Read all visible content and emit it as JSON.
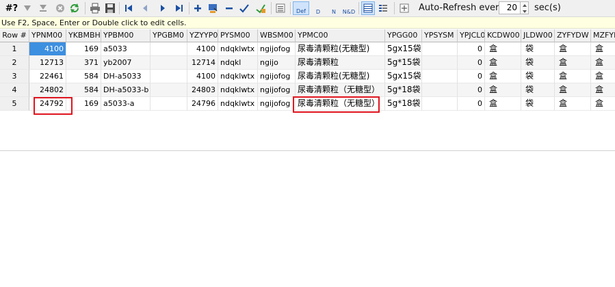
{
  "toolbar": {
    "filter_label": "#?",
    "auto_refresh_label": "Auto-Refresh every",
    "auto_refresh_value": "20",
    "auto_refresh_unit": "sec(s)",
    "def_label": "Def",
    "d_label": "D",
    "n_label": "N",
    "nd_label": "N&D"
  },
  "hint": "Use F2, Space, Enter or Double click to edit cells.",
  "grid": {
    "columns": [
      "Row #",
      "YPNM00",
      "YKBMBH",
      "YPBM00",
      "YPGBM0",
      "YZYYP0",
      "PYSM00",
      "WBSM00",
      "YPMC00",
      "YPGG00",
      "YPSYSM",
      "YPJCL0",
      "KCDW00",
      "JLDW00",
      "ZYFYDW",
      "MZFYDW"
    ],
    "rows": [
      {
        "rownum": "1",
        "ypnm": "4100",
        "ykbm": "169",
        "ypbm": "a5033",
        "ypgbm": "",
        "yzyyp": "4100",
        "pysm": "ndqklwtx",
        "wbsm": "ngijofog",
        "ypmc": "尿毒清颗粒(无糖型)",
        "ypgg": "5gx15袋",
        "ypsysm": "",
        "ypjcl": "0",
        "kcdw": "盒",
        "jldw": "袋",
        "zyfydw": "盒",
        "mzfydw": "盒"
      },
      {
        "rownum": "2",
        "ypnm": "12713",
        "ykbm": "371",
        "ypbm": "yb2007",
        "ypgbm": "",
        "yzyyp": "12714",
        "pysm": "ndqkl",
        "wbsm": "ngijo",
        "ypmc": "尿毒清颗粒",
        "ypgg": "5g*15袋",
        "ypsysm": "",
        "ypjcl": "0",
        "kcdw": "盒",
        "jldw": "袋",
        "zyfydw": "盒",
        "mzfydw": "盒"
      },
      {
        "rownum": "3",
        "ypnm": "22461",
        "ykbm": "584",
        "ypbm": "DH-a5033",
        "ypgbm": "",
        "yzyyp": "4100",
        "pysm": "ndqklwtx",
        "wbsm": "ngijofog",
        "ypmc": "尿毒清颗粒(无糖型)",
        "ypgg": "5gx15袋",
        "ypsysm": "",
        "ypjcl": "0",
        "kcdw": "盒",
        "jldw": "袋",
        "zyfydw": "盒",
        "mzfydw": "盒"
      },
      {
        "rownum": "4",
        "ypnm": "24802",
        "ykbm": "584",
        "ypbm": "DH-a5033-b",
        "ypgbm": "",
        "yzyyp": "24803",
        "pysm": "ndqklwtx",
        "wbsm": "ngijofog",
        "ypmc": "尿毒清颗粒（无糖型）",
        "ypgg": "5g*18袋",
        "ypsysm": "",
        "ypjcl": "0",
        "kcdw": "盒",
        "jldw": "袋",
        "zyfydw": "盒",
        "mzfydw": "盒"
      },
      {
        "rownum": "5",
        "ypnm": "24792",
        "ykbm": "169",
        "ypbm": "a5033-a",
        "ypgbm": "",
        "yzyyp": "24796",
        "pysm": "ndqklwtx",
        "wbsm": "ngijofog",
        "ypmc": "尿毒清颗粒（无糖型）",
        "ypgg": "5g*18袋",
        "ypsysm": "",
        "ypjcl": "0",
        "kcdw": "盒",
        "jldw": "袋",
        "zyfydw": "盒",
        "mzfydw": "盒"
      }
    ]
  },
  "colors": {
    "selection": "#3d8fe0",
    "highlight": "#e0141e",
    "hint_bg": "#ffffe1"
  }
}
